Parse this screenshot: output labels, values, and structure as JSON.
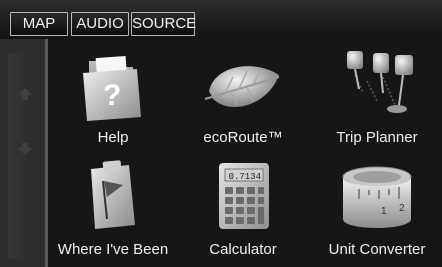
{
  "tabs": [
    {
      "label": "MAP"
    },
    {
      "label": "AUDIO"
    },
    {
      "label": "SOURCE"
    }
  ],
  "sidebar": {
    "up_icon": "chevron-up-icon",
    "down_icon": "chevron-down-icon"
  },
  "apps": [
    {
      "label": "Help",
      "icon": "help-folder-icon"
    },
    {
      "label": "ecoRoute™",
      "icon": "leaf-icon"
    },
    {
      "label": "Trip Planner",
      "icon": "pushpins-icon"
    },
    {
      "label": "Where I've Been",
      "icon": "clipboard-flag-icon"
    },
    {
      "label": "Calculator",
      "icon": "calculator-icon"
    },
    {
      "label": "Unit Converter",
      "icon": "tape-measure-icon"
    }
  ],
  "calculator_display": "0.7134",
  "colors": {
    "background": "#161616",
    "sidebar": "#2d2d2d",
    "text": "#f0f0f0",
    "tab_border": "#b9b9b9"
  }
}
